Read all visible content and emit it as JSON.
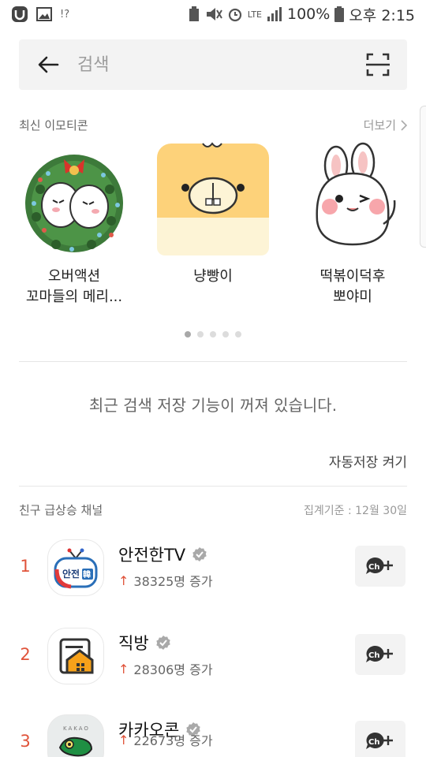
{
  "status_bar": {
    "notification_text": "!?",
    "network": "LTE",
    "battery": "100%",
    "time": "오후 2:15"
  },
  "search": {
    "placeholder": "검색",
    "value": ""
  },
  "emoticons": {
    "section_title": "최신 이모티콘",
    "more_label": "더보기",
    "items": [
      {
        "name_line1": "오버액션",
        "name_line2": "꼬마들의 메리..."
      },
      {
        "name_line1": "냥빵이",
        "name_line2": ""
      },
      {
        "name_line1": "떡볶이덕후",
        "name_line2": "뽀야미"
      }
    ],
    "page_count": 5,
    "active_page": 1
  },
  "recent_search": {
    "message": "최근 검색 저장 기능이 꺼져 있습니다.",
    "toggle_label": "자동저장 켜기"
  },
  "channels": {
    "section_title": "친구 급상승 채널",
    "date_label": "집계기준 : 12월 30일",
    "items": [
      {
        "rank": "1",
        "name": "안전한TV",
        "growth": "38325명 증가"
      },
      {
        "rank": "2",
        "name": "직방",
        "growth": "28306명 증가"
      },
      {
        "rank": "3",
        "name": "카카오콘",
        "growth": "22673명 증가"
      }
    ]
  },
  "colors": {
    "accent": "#e0533a",
    "background": "#ffffff",
    "field_bg": "#f3f3f3"
  }
}
